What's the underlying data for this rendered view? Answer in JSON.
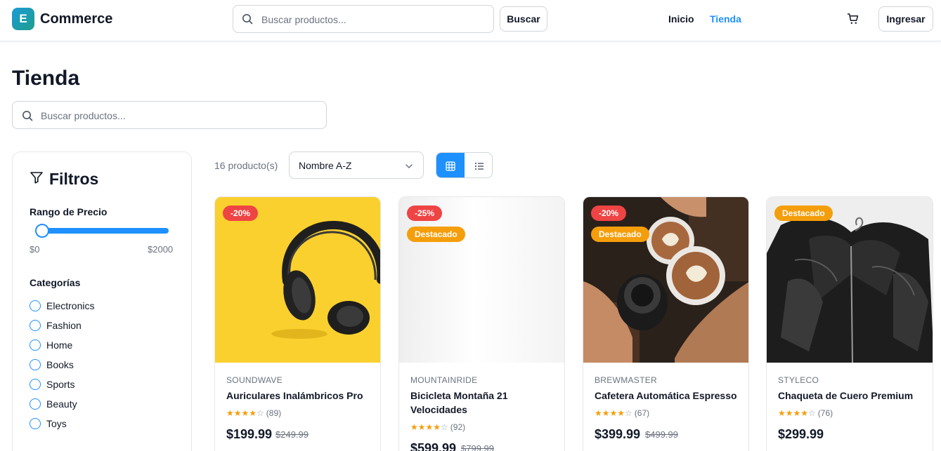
{
  "header": {
    "logo_letter": "E",
    "brand": "Commerce",
    "search_placeholder": "Buscar productos...",
    "search_button": "Buscar",
    "nav": [
      "Inicio",
      "Tienda"
    ],
    "active_nav": "Tienda",
    "login_button": "Ingresar",
    "icons": {
      "search": "search-icon",
      "cart": "cart-icon"
    }
  },
  "page": {
    "title": "Tienda",
    "search_placeholder": "Buscar productos..."
  },
  "filters": {
    "title": "Filtros",
    "price_label": "Rango de Precio",
    "price_min": "$0",
    "price_max": "$2000",
    "categories_label": "Categorías",
    "categories": [
      "Electronics",
      "Fashion",
      "Home",
      "Books",
      "Sports",
      "Beauty",
      "Toys"
    ]
  },
  "toolbar": {
    "count": "16 producto(s)",
    "sort_value": "Nombre A-Z",
    "view_mode": "grid"
  },
  "products": [
    {
      "brand": "SOUNDWAVE",
      "name": "Auriculares Inalámbricos Pro",
      "rating": 4,
      "reviews": "(89)",
      "price": "$199.99",
      "old_price": "$249.99",
      "badges": [
        "-20%"
      ]
    },
    {
      "brand": "MOUNTAINRIDE",
      "name": "Bicicleta Montaña 21 Velocidades",
      "rating": 4,
      "reviews": "(92)",
      "price": "$599.99",
      "old_price": "$799.99",
      "badges": [
        "-25%",
        "Destacado"
      ]
    },
    {
      "brand": "BREWMASTER",
      "name": "Cafetera Automática Espresso",
      "rating": 4,
      "reviews": "(67)",
      "price": "$399.99",
      "old_price": "$499.99",
      "badges": [
        "-20%",
        "Destacado"
      ]
    },
    {
      "brand": "STYLECO",
      "name": "Chaqueta de Cuero Premium",
      "rating": 4,
      "reviews": "(76)",
      "price": "$299.99",
      "old_price": "",
      "badges": [
        "Destacado"
      ]
    }
  ],
  "colors": {
    "accent": "#1e90ff",
    "discount": "#ef4444",
    "featured": "#f59e0b",
    "star": "#f59e0b"
  }
}
